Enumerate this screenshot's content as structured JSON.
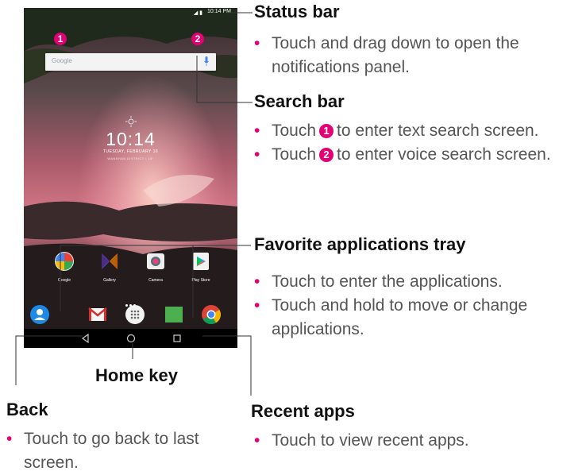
{
  "phone": {
    "status_time": "10:14 PM",
    "status_icons": "◢ ▮",
    "search_logo": "Google",
    "badge_1": "1",
    "badge_2": "2",
    "clock_time": "10:14",
    "clock_date": "TUESDAY, FEBRUARY 16",
    "clock_location": "WANSHAN DISTRICT • 18°",
    "apps": [
      {
        "label": "Google",
        "icon": "google-folder-icon"
      },
      {
        "label": "Gallery",
        "icon": "gallery-icon"
      },
      {
        "label": "Camera",
        "icon": "camera-icon"
      },
      {
        "label": "Play Store",
        "icon": "play-store-icon"
      }
    ],
    "dock": [
      "contacts-icon",
      "gmail-icon",
      "app-drawer-icon",
      "messages-icon",
      "chrome-icon"
    ],
    "nav": [
      "back-icon",
      "home-icon",
      "recent-apps-icon"
    ]
  },
  "sections": {
    "status_bar": {
      "title": "Status bar",
      "bullets": [
        "Touch and drag down to open the notifications panel."
      ]
    },
    "search_bar": {
      "title": "Search bar",
      "bullet1_pre": "Touch",
      "bullet1_num": "1",
      "bullet1_post": "to enter text search screen.",
      "bullet2_pre": "Touch",
      "bullet2_num": "2",
      "bullet2_post": "to enter voice search screen."
    },
    "favorites": {
      "title": "Favorite applications tray",
      "bullets": [
        "Touch to enter the applications.",
        "Touch and hold to move or change applications."
      ]
    },
    "home_key": {
      "title": "Home key"
    },
    "back": {
      "title": "Back",
      "bullets": [
        "Touch to go back to last screen."
      ]
    },
    "recent_apps": {
      "title": "Recent apps",
      "bullets": [
        "Touch to view recent apps."
      ]
    }
  },
  "colors": {
    "accent": "#e20074",
    "heading": "#111111",
    "body": "#555555"
  }
}
